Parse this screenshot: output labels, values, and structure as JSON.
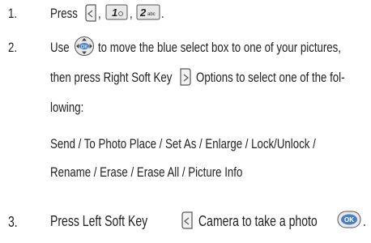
{
  "steps": [
    {
      "number": "1.",
      "press": "Press",
      "sep1": ",",
      "sep2": ",",
      "end": ".",
      "keys": [
        "left-soft-key-icon",
        "1-key-icon",
        "2abc-key-icon"
      ],
      "key1_label": "1",
      "key2_label": "2",
      "key2_sub": "abc"
    },
    {
      "number": "2.",
      "use": "Use",
      "line1_rest": "to move the blue select box to one of your pictures,",
      "line2_start": "then press Right Soft Key",
      "line2_rest": "Options to select one of the fol-",
      "line3": "lowing:",
      "options_line1": "Send / To Photo Place / Set As / Enlarge / Lock/Unlock /",
      "options_line2": "Rename / Erase / Erase All / Picture Info",
      "nav_key_label": "OK"
    },
    {
      "number": "3.",
      "start": "Press Left Soft Key",
      "middle": "Camera to take a photo",
      "end": ".",
      "ok_label": "OK"
    }
  ],
  "colors": {
    "text": "#222222",
    "icon_stroke": "#555555",
    "icon_fill": "#e9e9e9",
    "ok_fill": "#4a7fc4"
  }
}
